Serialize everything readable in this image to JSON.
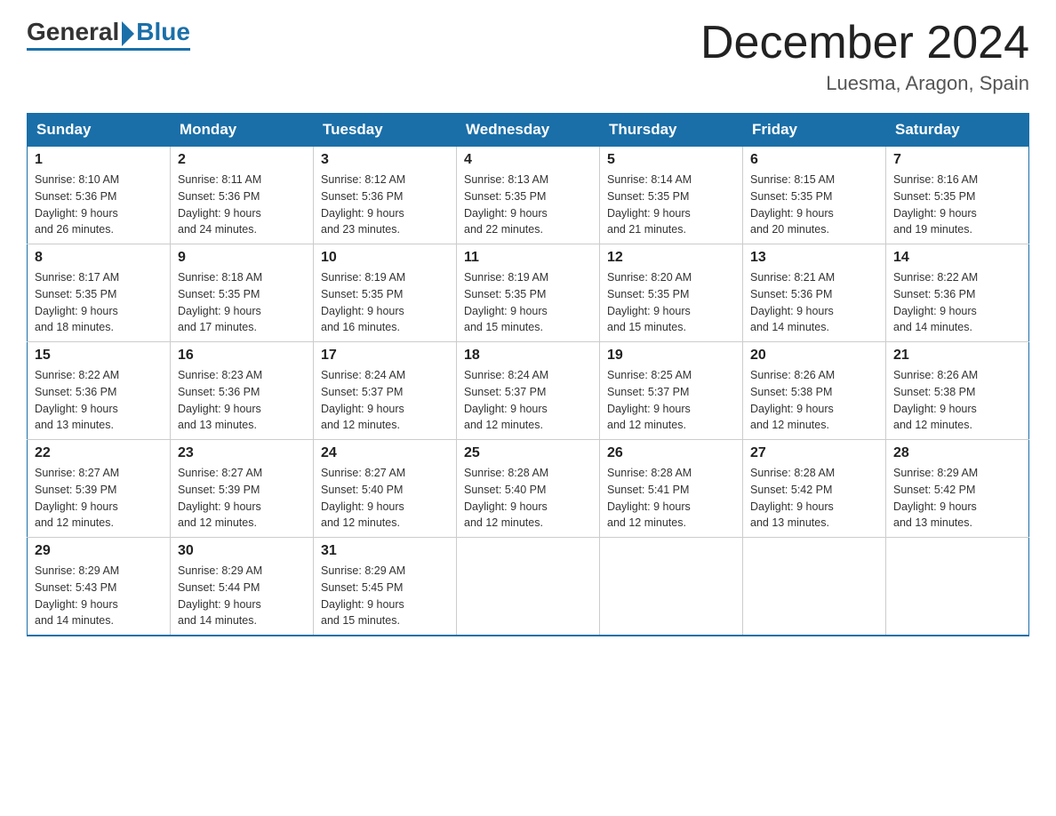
{
  "header": {
    "logo_general": "General",
    "logo_blue": "Blue",
    "month_title": "December 2024",
    "location": "Luesma, Aragon, Spain"
  },
  "days_of_week": [
    "Sunday",
    "Monday",
    "Tuesday",
    "Wednesday",
    "Thursday",
    "Friday",
    "Saturday"
  ],
  "weeks": [
    [
      {
        "day": "1",
        "sunrise": "8:10 AM",
        "sunset": "5:36 PM",
        "daylight": "9 hours and 26 minutes."
      },
      {
        "day": "2",
        "sunrise": "8:11 AM",
        "sunset": "5:36 PM",
        "daylight": "9 hours and 24 minutes."
      },
      {
        "day": "3",
        "sunrise": "8:12 AM",
        "sunset": "5:36 PM",
        "daylight": "9 hours and 23 minutes."
      },
      {
        "day": "4",
        "sunrise": "8:13 AM",
        "sunset": "5:35 PM",
        "daylight": "9 hours and 22 minutes."
      },
      {
        "day": "5",
        "sunrise": "8:14 AM",
        "sunset": "5:35 PM",
        "daylight": "9 hours and 21 minutes."
      },
      {
        "day": "6",
        "sunrise": "8:15 AM",
        "sunset": "5:35 PM",
        "daylight": "9 hours and 20 minutes."
      },
      {
        "day": "7",
        "sunrise": "8:16 AM",
        "sunset": "5:35 PM",
        "daylight": "9 hours and 19 minutes."
      }
    ],
    [
      {
        "day": "8",
        "sunrise": "8:17 AM",
        "sunset": "5:35 PM",
        "daylight": "9 hours and 18 minutes."
      },
      {
        "day": "9",
        "sunrise": "8:18 AM",
        "sunset": "5:35 PM",
        "daylight": "9 hours and 17 minutes."
      },
      {
        "day": "10",
        "sunrise": "8:19 AM",
        "sunset": "5:35 PM",
        "daylight": "9 hours and 16 minutes."
      },
      {
        "day": "11",
        "sunrise": "8:19 AM",
        "sunset": "5:35 PM",
        "daylight": "9 hours and 15 minutes."
      },
      {
        "day": "12",
        "sunrise": "8:20 AM",
        "sunset": "5:35 PM",
        "daylight": "9 hours and 15 minutes."
      },
      {
        "day": "13",
        "sunrise": "8:21 AM",
        "sunset": "5:36 PM",
        "daylight": "9 hours and 14 minutes."
      },
      {
        "day": "14",
        "sunrise": "8:22 AM",
        "sunset": "5:36 PM",
        "daylight": "9 hours and 14 minutes."
      }
    ],
    [
      {
        "day": "15",
        "sunrise": "8:22 AM",
        "sunset": "5:36 PM",
        "daylight": "9 hours and 13 minutes."
      },
      {
        "day": "16",
        "sunrise": "8:23 AM",
        "sunset": "5:36 PM",
        "daylight": "9 hours and 13 minutes."
      },
      {
        "day": "17",
        "sunrise": "8:24 AM",
        "sunset": "5:37 PM",
        "daylight": "9 hours and 12 minutes."
      },
      {
        "day": "18",
        "sunrise": "8:24 AM",
        "sunset": "5:37 PM",
        "daylight": "9 hours and 12 minutes."
      },
      {
        "day": "19",
        "sunrise": "8:25 AM",
        "sunset": "5:37 PM",
        "daylight": "9 hours and 12 minutes."
      },
      {
        "day": "20",
        "sunrise": "8:26 AM",
        "sunset": "5:38 PM",
        "daylight": "9 hours and 12 minutes."
      },
      {
        "day": "21",
        "sunrise": "8:26 AM",
        "sunset": "5:38 PM",
        "daylight": "9 hours and 12 minutes."
      }
    ],
    [
      {
        "day": "22",
        "sunrise": "8:27 AM",
        "sunset": "5:39 PM",
        "daylight": "9 hours and 12 minutes."
      },
      {
        "day": "23",
        "sunrise": "8:27 AM",
        "sunset": "5:39 PM",
        "daylight": "9 hours and 12 minutes."
      },
      {
        "day": "24",
        "sunrise": "8:27 AM",
        "sunset": "5:40 PM",
        "daylight": "9 hours and 12 minutes."
      },
      {
        "day": "25",
        "sunrise": "8:28 AM",
        "sunset": "5:40 PM",
        "daylight": "9 hours and 12 minutes."
      },
      {
        "day": "26",
        "sunrise": "8:28 AM",
        "sunset": "5:41 PM",
        "daylight": "9 hours and 12 minutes."
      },
      {
        "day": "27",
        "sunrise": "8:28 AM",
        "sunset": "5:42 PM",
        "daylight": "9 hours and 13 minutes."
      },
      {
        "day": "28",
        "sunrise": "8:29 AM",
        "sunset": "5:42 PM",
        "daylight": "9 hours and 13 minutes."
      }
    ],
    [
      {
        "day": "29",
        "sunrise": "8:29 AM",
        "sunset": "5:43 PM",
        "daylight": "9 hours and 14 minutes."
      },
      {
        "day": "30",
        "sunrise": "8:29 AM",
        "sunset": "5:44 PM",
        "daylight": "9 hours and 14 minutes."
      },
      {
        "day": "31",
        "sunrise": "8:29 AM",
        "sunset": "5:45 PM",
        "daylight": "9 hours and 15 minutes."
      },
      null,
      null,
      null,
      null
    ]
  ],
  "labels": {
    "sunrise": "Sunrise:",
    "sunset": "Sunset:",
    "daylight": "Daylight:"
  }
}
